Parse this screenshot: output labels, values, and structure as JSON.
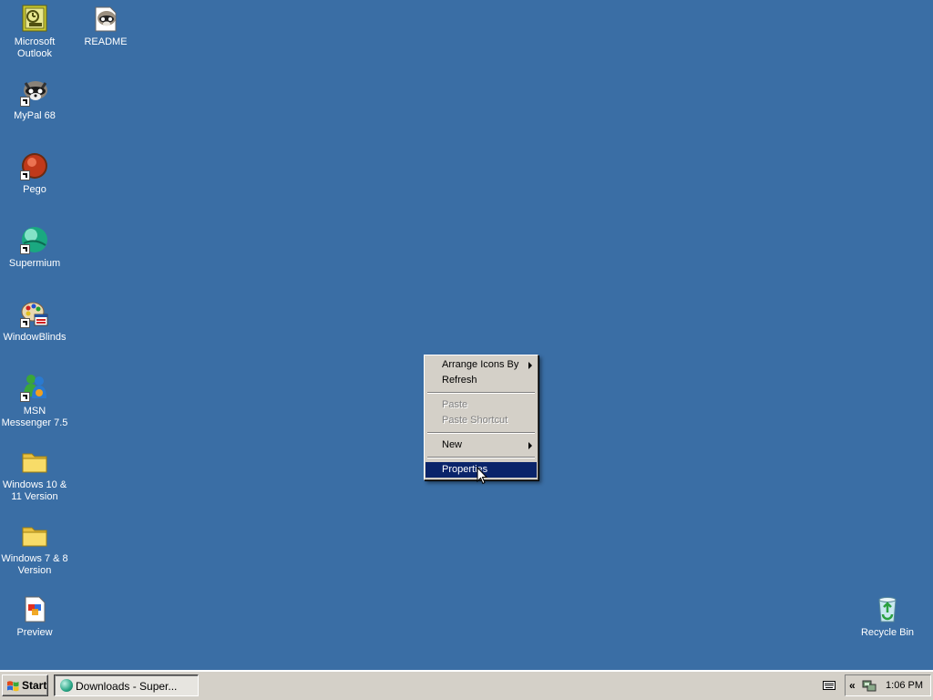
{
  "desktop": {
    "background_color": "#3a6ea5",
    "icons": [
      {
        "label": "Microsoft\nOutlook",
        "icon": "outlook-icon"
      },
      {
        "label": "README",
        "icon": "readme-document-icon"
      },
      {
        "label": "MyPal 68",
        "icon": "mypal-raccoon-icon",
        "shortcut": true
      },
      {
        "label": "Pego",
        "icon": "pego-red-ball-icon",
        "shortcut": true
      },
      {
        "label": "Supermium",
        "icon": "supermium-globe-icon",
        "shortcut": true
      },
      {
        "label": "WindowBlinds",
        "icon": "windowblinds-palette-icon",
        "shortcut": true
      },
      {
        "label": "MSN\nMessenger 7.5",
        "icon": "msn-messenger-icon",
        "shortcut": true
      },
      {
        "label": "Windows 10 &\n11 Version",
        "icon": "folder-icon"
      },
      {
        "label": "Windows 7 & 8\nVersion",
        "icon": "folder-icon"
      },
      {
        "label": "Preview",
        "icon": "preview-document-icon"
      },
      {
        "label": "Recycle Bin",
        "icon": "recycle-bin-icon"
      }
    ]
  },
  "context_menu": {
    "items": [
      {
        "label": "Arrange Icons By",
        "submenu": true,
        "enabled": true
      },
      {
        "label": "Refresh",
        "enabled": true
      },
      {
        "label": "Paste",
        "enabled": false
      },
      {
        "label": "Paste Shortcut",
        "enabled": false
      },
      {
        "label": "New",
        "submenu": true,
        "enabled": true
      },
      {
        "label": "Properties",
        "enabled": true,
        "selected": true
      }
    ],
    "selection_color": "#0a246a"
  },
  "taskbar": {
    "start_label": "Start",
    "tasks": [
      {
        "label": "Downloads - Super...",
        "icon": "supermium-globe-icon",
        "active": true
      }
    ],
    "tray": {
      "chevron": "«",
      "time": "1:06 PM"
    }
  }
}
